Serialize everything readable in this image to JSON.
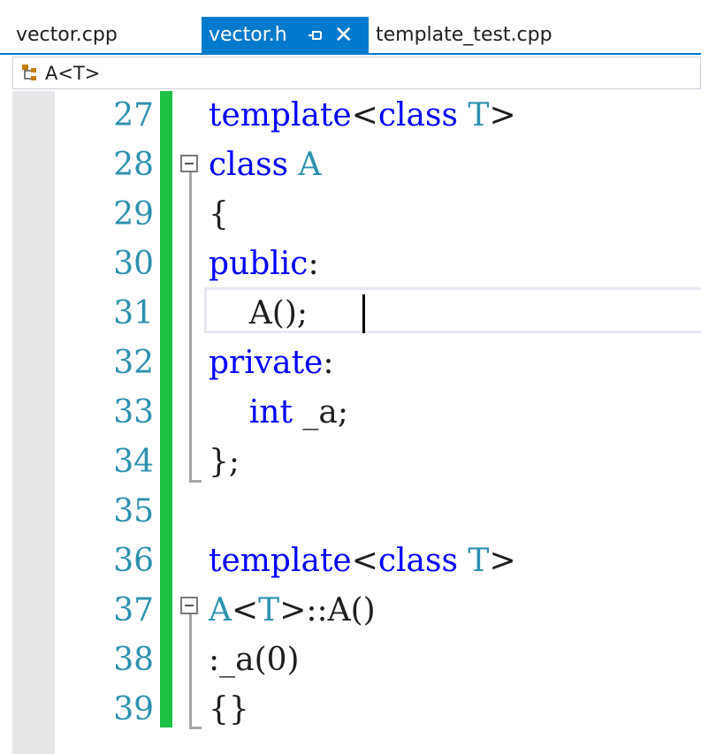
{
  "tabs": [
    {
      "label": "vector.cpp",
      "active": false
    },
    {
      "label": "vector.h",
      "active": true,
      "pin_icon": "pin-icon",
      "close_icon": "close-icon"
    },
    {
      "label": "template_test.cpp",
      "active": false
    }
  ],
  "navbar": {
    "icon": "class-icon",
    "text": "A<T>"
  },
  "colors": {
    "accent": "#007acc",
    "keyword": "#0000ff",
    "type": "#2b91af",
    "line_number": "#2b91af",
    "change_bar": "#1ec144"
  },
  "editor": {
    "lines": [
      {
        "no": "27",
        "t1": "template",
        "t2": "<",
        "t3": "class",
        "t4": " ",
        "t5": "T",
        "t6": ">"
      },
      {
        "no": "28",
        "t1": "class",
        "t2": " ",
        "t3": "A"
      },
      {
        "no": "29",
        "t1": "{"
      },
      {
        "no": "30",
        "t1": "public",
        "t2": ":"
      },
      {
        "no": "31",
        "t1": "    A();"
      },
      {
        "no": "32",
        "t1": "private",
        "t2": ":"
      },
      {
        "no": "33",
        "t1": "    ",
        "t2": "int",
        "t3": " _a;"
      },
      {
        "no": "34",
        "t1": "};"
      },
      {
        "no": "35"
      },
      {
        "no": "36",
        "t1": "template",
        "t2": "<",
        "t3": "class",
        "t4": " ",
        "t5": "T",
        "t6": ">"
      },
      {
        "no": "37",
        "t1": "A",
        "t2": "<",
        "t3": "T",
        "t4": ">::A()"
      },
      {
        "no": "38",
        "t1": ":_a(0)"
      },
      {
        "no": "39",
        "t1": "{}"
      }
    ]
  }
}
